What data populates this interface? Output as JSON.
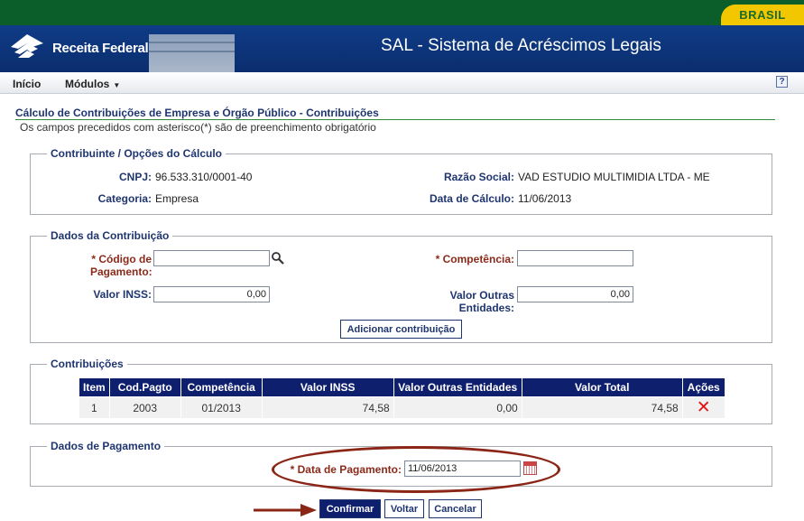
{
  "brand": {
    "gov_badge": "BRASIL",
    "org_name": "Receita Federal",
    "system_title": "SAL - Sistema de Acréscimos Legais"
  },
  "menu": {
    "home": "Início",
    "modules": "Módulos",
    "help": "?"
  },
  "page": {
    "title": "Cálculo de Contribuições de Empresa e Órgão Público - Contribuições",
    "required_note": "Os campos precedidos com asterisco(*) são de preenchimento obrigatório"
  },
  "contribuinte": {
    "legend": "Contribuinte / Opções do Cálculo",
    "cnpj_label": "CNPJ:",
    "cnpj_value": "96.533.310/0001-40",
    "razao_label": "Razão Social:",
    "razao_value": "VAD ESTUDIO MULTIMIDIA LTDA - ME",
    "categoria_label": "Categoria:",
    "categoria_value": "Empresa",
    "data_calculo_label": "Data de Cálculo:",
    "data_calculo_value": "11/06/2013"
  },
  "dados_contribuicao": {
    "legend": "Dados da Contribuição",
    "codigo_label_1": "* Código de",
    "codigo_label_2": "Pagamento:",
    "codigo_value": "",
    "competencia_label": "* Competência:",
    "competencia_value": "",
    "valor_inss_label": "Valor INSS:",
    "valor_inss_value": "0,00",
    "valor_outras_label_1": "Valor Outras",
    "valor_outras_label_2": "Entidades:",
    "valor_outras_value": "0,00",
    "add_button": "Adicionar contribuição"
  },
  "contribuicoes": {
    "legend": "Contribuições",
    "headers": [
      "Item",
      "Cod.Pagto",
      "Competência",
      "Valor INSS",
      "Valor Outras Entidades",
      "Valor Total",
      "Ações"
    ],
    "rows": [
      {
        "item": "1",
        "cod_pagto": "2003",
        "competencia": "01/2013",
        "valor_inss": "74,58",
        "valor_outras": "0,00",
        "valor_total": "74,58",
        "acao_icon": "delete-x-icon"
      }
    ]
  },
  "pagamento": {
    "legend": "Dados de Pagamento",
    "data_label": "* Data de Pagamento:",
    "data_value": "11/06/2013"
  },
  "actions": {
    "confirm": "Confirmar",
    "back": "Voltar",
    "cancel": "Cancelar"
  },
  "colors": {
    "header_blue": "#0f3c87",
    "gov_green": "#0b5d2a",
    "badge_yellow": "#f3c700",
    "table_header": "#0e1f6e",
    "annotation_red": "#8b2516"
  }
}
